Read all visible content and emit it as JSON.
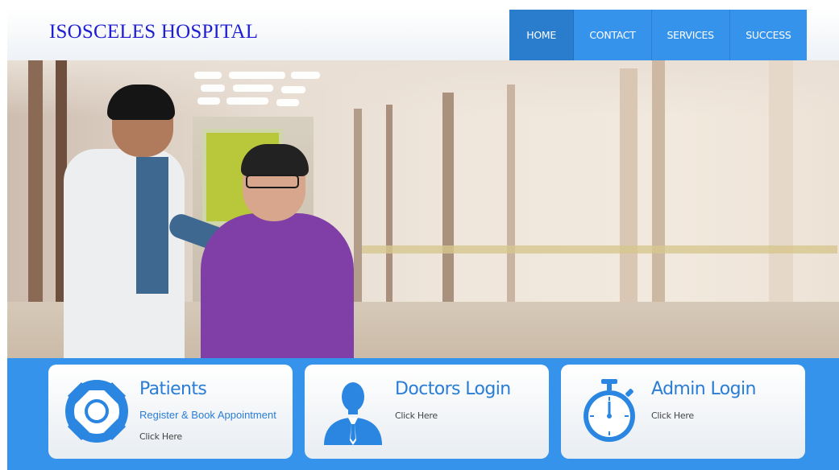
{
  "header": {
    "logo_text": "ISOSCELES HOSPITAL",
    "nav": [
      {
        "label": "HOME",
        "active": true
      },
      {
        "label": "CONTACT",
        "active": false
      },
      {
        "label": "SERVICES",
        "active": false
      },
      {
        "label": "SUCCESS",
        "active": false
      }
    ]
  },
  "hero": {
    "image_subject": "doctor-with-patient-in-corridor"
  },
  "features": [
    {
      "title": "Patients",
      "subtitle": "Register & Book Appointment",
      "link": "Click Here",
      "icon": "lifebuoy-icon"
    },
    {
      "title": "Doctors Login",
      "link": "Click Here",
      "icon": "doctor-icon"
    },
    {
      "title": "Admin Login",
      "link": "Click Here",
      "icon": "stopwatch-icon"
    }
  ],
  "colors": {
    "accent": "#3693ec",
    "nav_active": "#2a7ccc",
    "logo": "#1f1fd2",
    "card_title": "#2a7dd6"
  }
}
